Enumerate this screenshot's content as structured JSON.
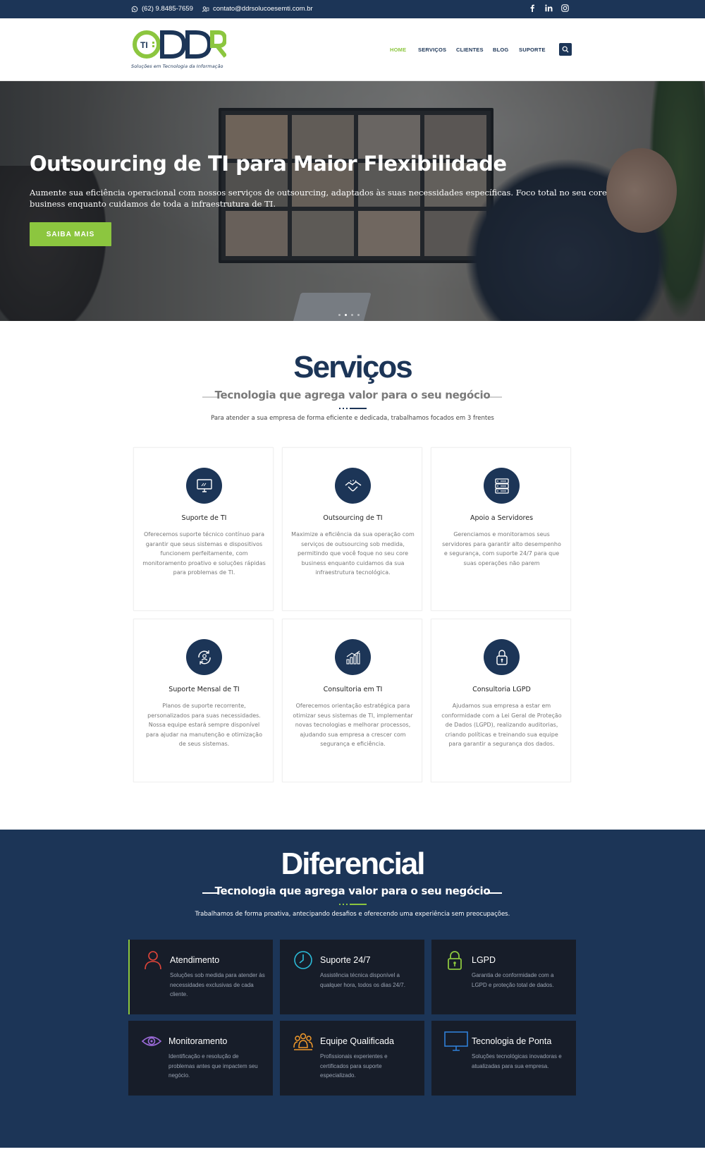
{
  "topbar": {
    "phone": "(62) 9.8485-7659",
    "email": "contato@ddrsolucoesemti.com.br",
    "social_icons": [
      "facebook-icon",
      "linkedin-icon",
      "instagram-icon"
    ]
  },
  "brand": {
    "logo_badge": "TI",
    "logo_letters": "DDR",
    "tagline": "Soluções em Tecnologia da Informação",
    "colors": {
      "navy": "#1c3557",
      "green": "#8cc63f",
      "dark_card": "#171d29"
    }
  },
  "nav": {
    "items": [
      {
        "label": "HOME",
        "active": true
      },
      {
        "label": "SERVIÇOS",
        "active": false
      },
      {
        "label": "CLIENTES",
        "active": false
      },
      {
        "label": "BLOG",
        "active": false
      },
      {
        "label": "SUPORTE",
        "active": false
      }
    ],
    "search_icon": "search-icon"
  },
  "hero": {
    "title": "Outsourcing de TI para Maior Flexibilidade",
    "text": "Aumente sua eficiência operacional com nossos serviços de outsourcing, adaptados às suas necessidades específicas. Foco total no seu core business enquanto cuidamos de toda a infraestrutura de TI.",
    "button": "SAIBA MAIS",
    "slide_count": 4,
    "active_slide": 2
  },
  "servicos": {
    "title": "Serviços",
    "subtitle": "Tecnologia que agrega valor para o seu negócio",
    "desc": "Para atender a sua empresa de forma eficiente e dedicada, trabalhamos focados em 3 frentes",
    "cards": [
      {
        "title": "Suporte de TI",
        "icon": "monitor-icon",
        "text": "Oferecemos suporte técnico contínuo para garantir que seus sistemas e dispositivos funcionem perfeitamente, com monitoramento proativo e soluções rápidas para problemas de TI."
      },
      {
        "title": "Outsourcing de TI",
        "icon": "handshake-icon",
        "text": "Maximize a eficiência da sua operação com serviços de outsourcing sob medida, permitindo que você foque no seu core business enquanto cuidamos da sua infraestrutura tecnológica."
      },
      {
        "title": "Apoio a Servidores",
        "icon": "server-icon",
        "text": "Gerenciamos e monitoramos seus servidores para garantir alto desempenho e segurança, com suporte 24/7 para que suas operações não parem"
      },
      {
        "title": "Suporte Mensal de TI",
        "icon": "support-cycle-icon",
        "text": "Planos de suporte recorrente, personalizados para suas necessidades. Nossa equipe estará sempre disponível para ajudar na manutenção e otimização de seus sistemas."
      },
      {
        "title": "Consultoria em TI",
        "icon": "growth-chart-icon",
        "text": "Oferecemos orientação estratégica para otimizar seus sistemas de TI, implementar novas tecnologias e melhorar processos, ajudando sua empresa a crescer com segurança e eficiência."
      },
      {
        "title": "Consultoria LGPD",
        "icon": "padlock-icon",
        "text": "Ajudamos sua empresa a estar em conformidade com a Lei Geral de Proteção de Dados (LGPD), realizando auditorias, criando políticas e treinando sua equipe para garantir a segurança dos dados."
      }
    ]
  },
  "diferencial": {
    "title": "Diferencial",
    "subtitle": "Tecnologia que agrega valor para o seu negócio",
    "desc": "Trabalhamos de forma proativa, antecipando desafios e oferecendo uma experiência sem preocupações.",
    "cards": [
      {
        "title": "Atendimento",
        "icon": "user-icon",
        "color": "#e0453a",
        "text": "Soluções sob medida para atender às necessidades exclusivas de cada cliente."
      },
      {
        "title": "Suporte 24/7",
        "icon": "clock-icon",
        "color": "#2bbbd8",
        "text": "Assistência técnica disponível a qualquer hora, todos os dias 24/7."
      },
      {
        "title": "LGPD",
        "icon": "padlock-icon",
        "color": "#8cc63f",
        "text": "Garantia de conformidade com a LGPD e proteção total de dados."
      },
      {
        "title": "Monitoramento",
        "icon": "eye-icon",
        "color": "#9b6ad8",
        "text": "Identificação e resolução de problemas antes que impactem seu negócio."
      },
      {
        "title": "Equipe Qualificada",
        "icon": "team-icon",
        "color": "#f39a2b",
        "text": "Profissionais experientes e certificados para suporte especializado."
      },
      {
        "title": "Tecnologia de Ponta",
        "icon": "monitor-icon",
        "color": "#2f7fd6",
        "text": "Soluções tecnológicas inovadoras e atualizadas para sua empresa."
      }
    ]
  }
}
